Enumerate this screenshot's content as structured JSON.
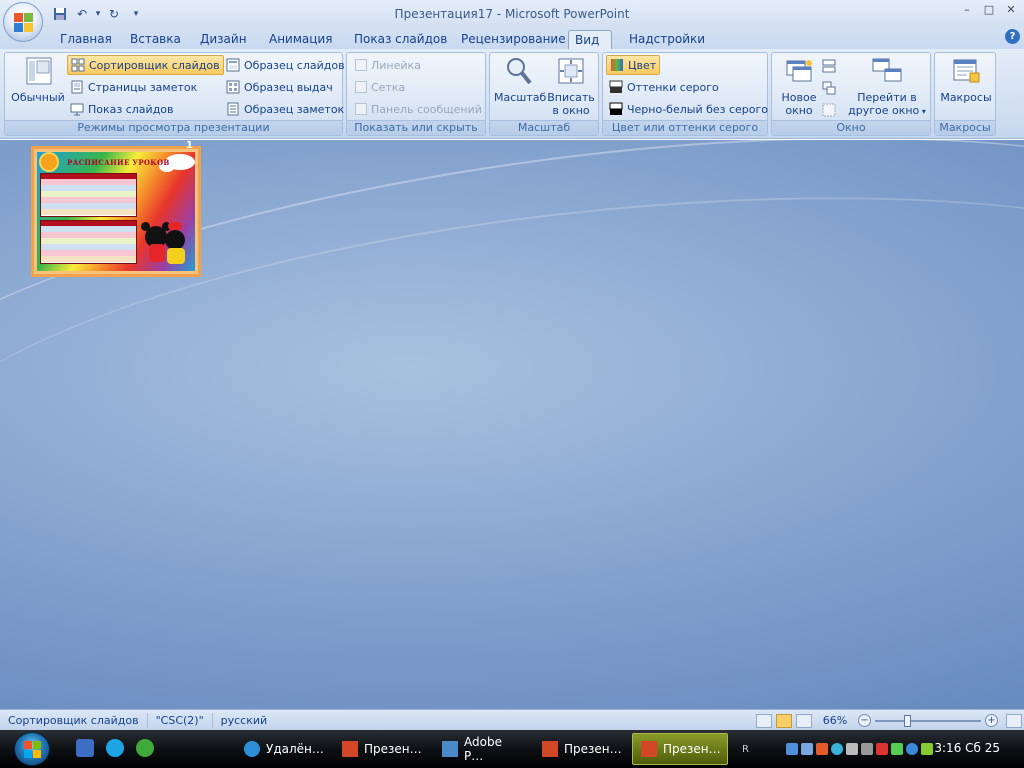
{
  "window": {
    "title": "Презентация17 - Microsoft PowerPoint",
    "minimize": "–",
    "maximize": "□",
    "close": "✕"
  },
  "qat": {
    "save_icon": "save-icon",
    "undo": "↶",
    "undo_dropdown": "▾",
    "redo": "↻",
    "customize": "▾"
  },
  "tabs": [
    "Главная",
    "Вставка",
    "Дизайн",
    "Анимация",
    "Показ слайдов",
    "Рецензирование",
    "Вид",
    "Надстройки"
  ],
  "active_tab": "Вид",
  "help": "?",
  "ribbon": {
    "views": {
      "label": "Режимы просмотра презентации",
      "normal": "Обычный",
      "slide_sorter": "Сортировщик слайдов",
      "notes_page": "Страницы заметок",
      "slide_show": "Показ слайдов",
      "slide_master": "Образец слайдов",
      "handout_master": "Образец выдач",
      "notes_master": "Образец заметок"
    },
    "show_hide": {
      "label": "Показать или скрыть",
      "ruler": "Линейка",
      "grid": "Сетка",
      "message_bar": "Панель сообщений"
    },
    "zoom": {
      "label": "Масштаб",
      "zoom": "Масштаб",
      "fit_line1": "Вписать",
      "fit_line2": "в окно"
    },
    "color": {
      "label": "Цвет или оттенки серого",
      "color": "Цвет",
      "grayscale": "Оттенки серого",
      "pure_bw": "Черно-белый без серого"
    },
    "window": {
      "label": "Окно",
      "new_line1": "Новое",
      "new_line2": "окно",
      "switch_line1": "Перейти в",
      "switch_line2": "другое окно"
    },
    "macros": {
      "label": "Макросы",
      "macros": "Макросы"
    }
  },
  "slides": [
    {
      "number": "1",
      "title": "РАСПИСАНИЕ УРОКОВ"
    }
  ],
  "status": {
    "view": "Сортировщик слайдов",
    "theme": "\"CSC(2)\"",
    "language": "русский",
    "zoom": "66%",
    "zoom_minus": "−",
    "zoom_plus": "+",
    "zoom_level": 0.66
  },
  "taskbar": {
    "tasks": [
      {
        "label": "Удалён…"
      },
      {
        "label": "Презен…"
      },
      {
        "label": "Adobe P…"
      },
      {
        "label": "Презен…"
      },
      {
        "label": "Презен…"
      },
      {
        "label": "R"
      }
    ],
    "clock": "3:16 Сб 25"
  },
  "colors": {
    "accent": "#f9c95e",
    "ribbon": "#d1dff1",
    "workspace": "#7f9ecb",
    "selection": "#f0a24a"
  }
}
